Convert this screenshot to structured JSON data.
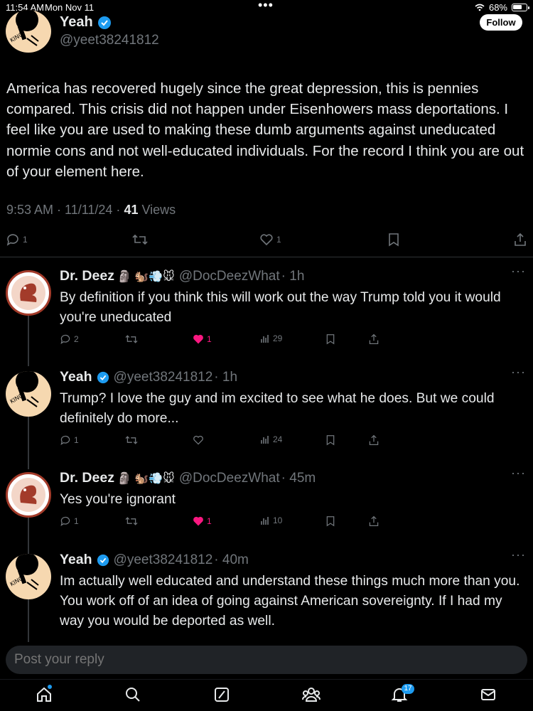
{
  "status_bar": {
    "time": "11:54 AM",
    "date": "Mon Nov 11",
    "battery": "68%"
  },
  "main_tweet": {
    "name": "Yeah",
    "handle": "@yeet38241812",
    "follow_label": "Follow",
    "text": "America has recovered hugely since the great depression, this is pennies compared. This crisis did not happen under Eisenhowers mass deportations. I feel like you are used to making these dumb arguments against uneducated normie cons and not well-educated individuals. For the record I think you are out of your element here.",
    "time": "9:53 AM · 11/11/24 · ",
    "views_count": "41",
    "views_label": " Views",
    "reply_count": "1",
    "like_count": "1"
  },
  "replies": [
    {
      "name": "Dr. Deez",
      "emoji": "🗿 🐿️💨🐭",
      "handle": "@DocDeezWhat",
      "time": "· 1h",
      "text": "By definition if you think this will work out the way Trump told you it would you're uneducated",
      "replies": "2",
      "retweets": "",
      "likes": "1",
      "views": "29",
      "liked": true
    },
    {
      "name": "Yeah",
      "emoji": "",
      "handle": "@yeet38241812",
      "time": "· 1h",
      "text": "Trump? I love the guy and im excited to see what he does. But we could definitely do more...",
      "replies": "1",
      "retweets": "",
      "likes": "",
      "views": "24",
      "liked": false
    },
    {
      "name": "Dr. Deez",
      "emoji": "🗿 🐿️💨🐭",
      "handle": "@DocDeezWhat",
      "time": "· 45m",
      "text": "Yes you're ignorant",
      "replies": "1",
      "retweets": "",
      "likes": "1",
      "views": "10",
      "liked": true
    },
    {
      "name": "Yeah",
      "emoji": "",
      "handle": "@yeet38241812",
      "time": "· 40m",
      "text": "Im actually well educated and understand these things much more than you. You work off of an idea of going against American sovereignty. If I had my way you would be deported as well."
    }
  ],
  "compose": {
    "placeholder": "Post your reply"
  },
  "nav": {
    "notifications_badge": "17"
  },
  "colors": {
    "accent": "#1d9bf0",
    "like": "#f91880",
    "muted": "#71767b",
    "background": "#000000"
  },
  "icons": [
    "home-icon",
    "search-icon",
    "grok-icon",
    "communities-icon",
    "bell-icon",
    "mail-icon",
    "verified-badge-icon"
  ]
}
